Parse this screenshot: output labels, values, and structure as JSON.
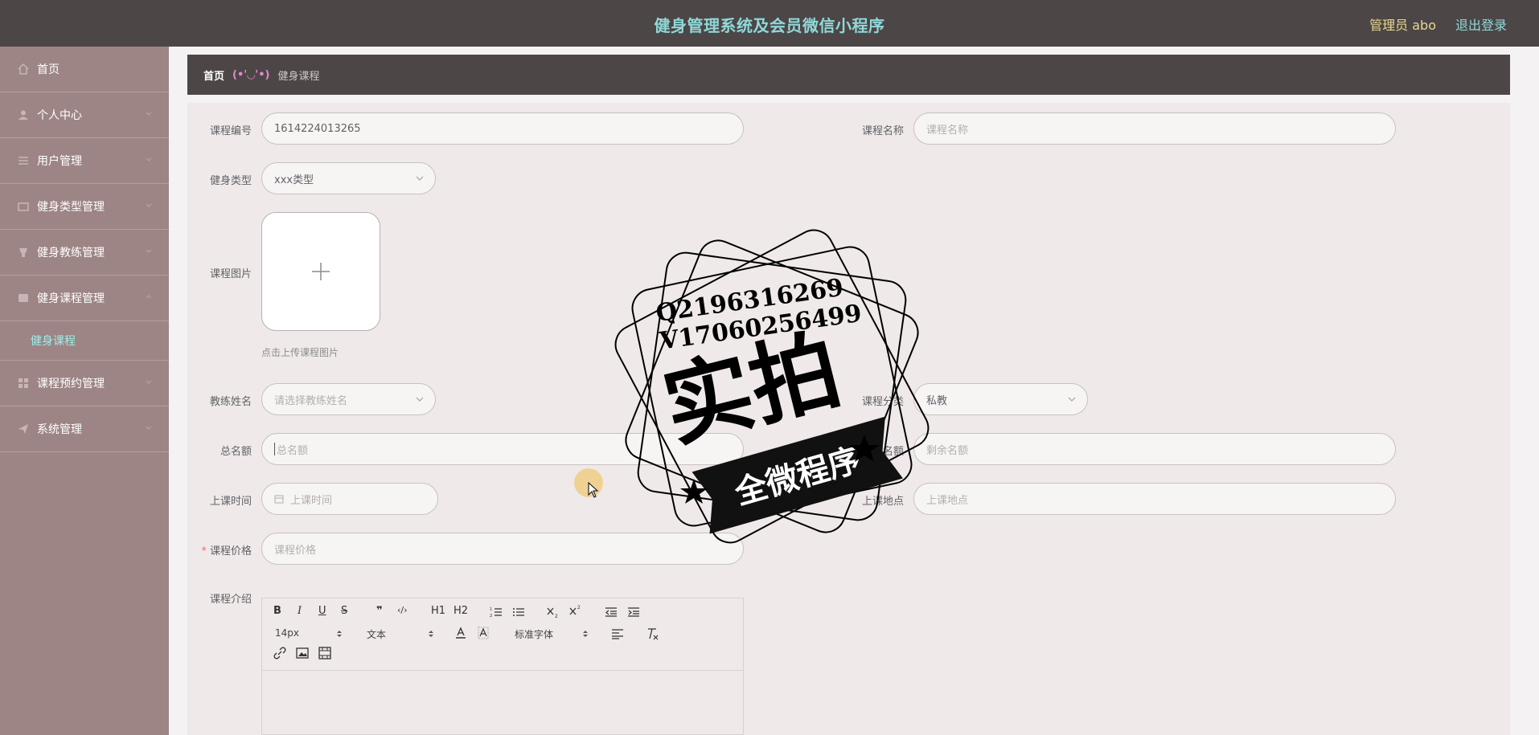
{
  "header": {
    "title": "健身管理系统及会员微信小程序",
    "user_label": "管理员 abo",
    "logout_label": "退出登录"
  },
  "sidebar": {
    "items": [
      {
        "label": "首页",
        "icon": "home-icon"
      },
      {
        "label": "个人中心",
        "icon": "user-icon"
      },
      {
        "label": "用户管理",
        "icon": "list-icon"
      },
      {
        "label": "健身类型管理",
        "icon": "folder-icon"
      },
      {
        "label": "健身教练管理",
        "icon": "coach-icon"
      },
      {
        "label": "健身课程管理",
        "icon": "course-icon"
      },
      {
        "label": "课程预约管理",
        "icon": "grid-icon"
      },
      {
        "label": "系统管理",
        "icon": "send-icon"
      }
    ],
    "active_sub": "健身课程"
  },
  "breadcrumb": {
    "home": "首页",
    "separator": "(•'◡'•)",
    "current": "健身课程"
  },
  "form": {
    "course_no": {
      "label": "课程编号",
      "value": "1614224013265"
    },
    "course_name": {
      "label": "课程名称",
      "placeholder": "课程名称"
    },
    "fitness_type": {
      "label": "健身类型",
      "value": "xxx类型"
    },
    "course_image": {
      "label": "课程图片",
      "hint": "点击上传课程图片"
    },
    "coach_name": {
      "label": "教练姓名",
      "placeholder": "请选择教练姓名"
    },
    "course_category": {
      "label": "课程分类",
      "value": "私教"
    },
    "total_quota": {
      "label": "总名额",
      "placeholder": "总名额"
    },
    "remaining_quota": {
      "label": "剩余名额",
      "placeholder": "剩余名额"
    },
    "class_time": {
      "label": "上课时间",
      "placeholder": "上课时间"
    },
    "class_location": {
      "label": "上课地点",
      "placeholder": "上课地点"
    },
    "course_price": {
      "label": "课程价格",
      "placeholder": "课程价格",
      "required": true
    },
    "course_intro": {
      "label": "课程介绍"
    }
  },
  "editor": {
    "font_size": "14px",
    "text_style": "文本",
    "font_family": "标准字体",
    "buttons": [
      "B",
      "I",
      "U",
      "S",
      "❞",
      "‹/›",
      "H1",
      "H2"
    ]
  },
  "watermark": {
    "line1": "Q2196316269",
    "line2": "V17060256499",
    "main": "实拍",
    "ribbon": "全微程序"
  },
  "colors": {
    "header_bg": "#4d4646",
    "title": "#8fd8d8",
    "sidebar_bg": "#9e8585",
    "active_sub": "#9af0ea",
    "user": "#e6d890"
  }
}
